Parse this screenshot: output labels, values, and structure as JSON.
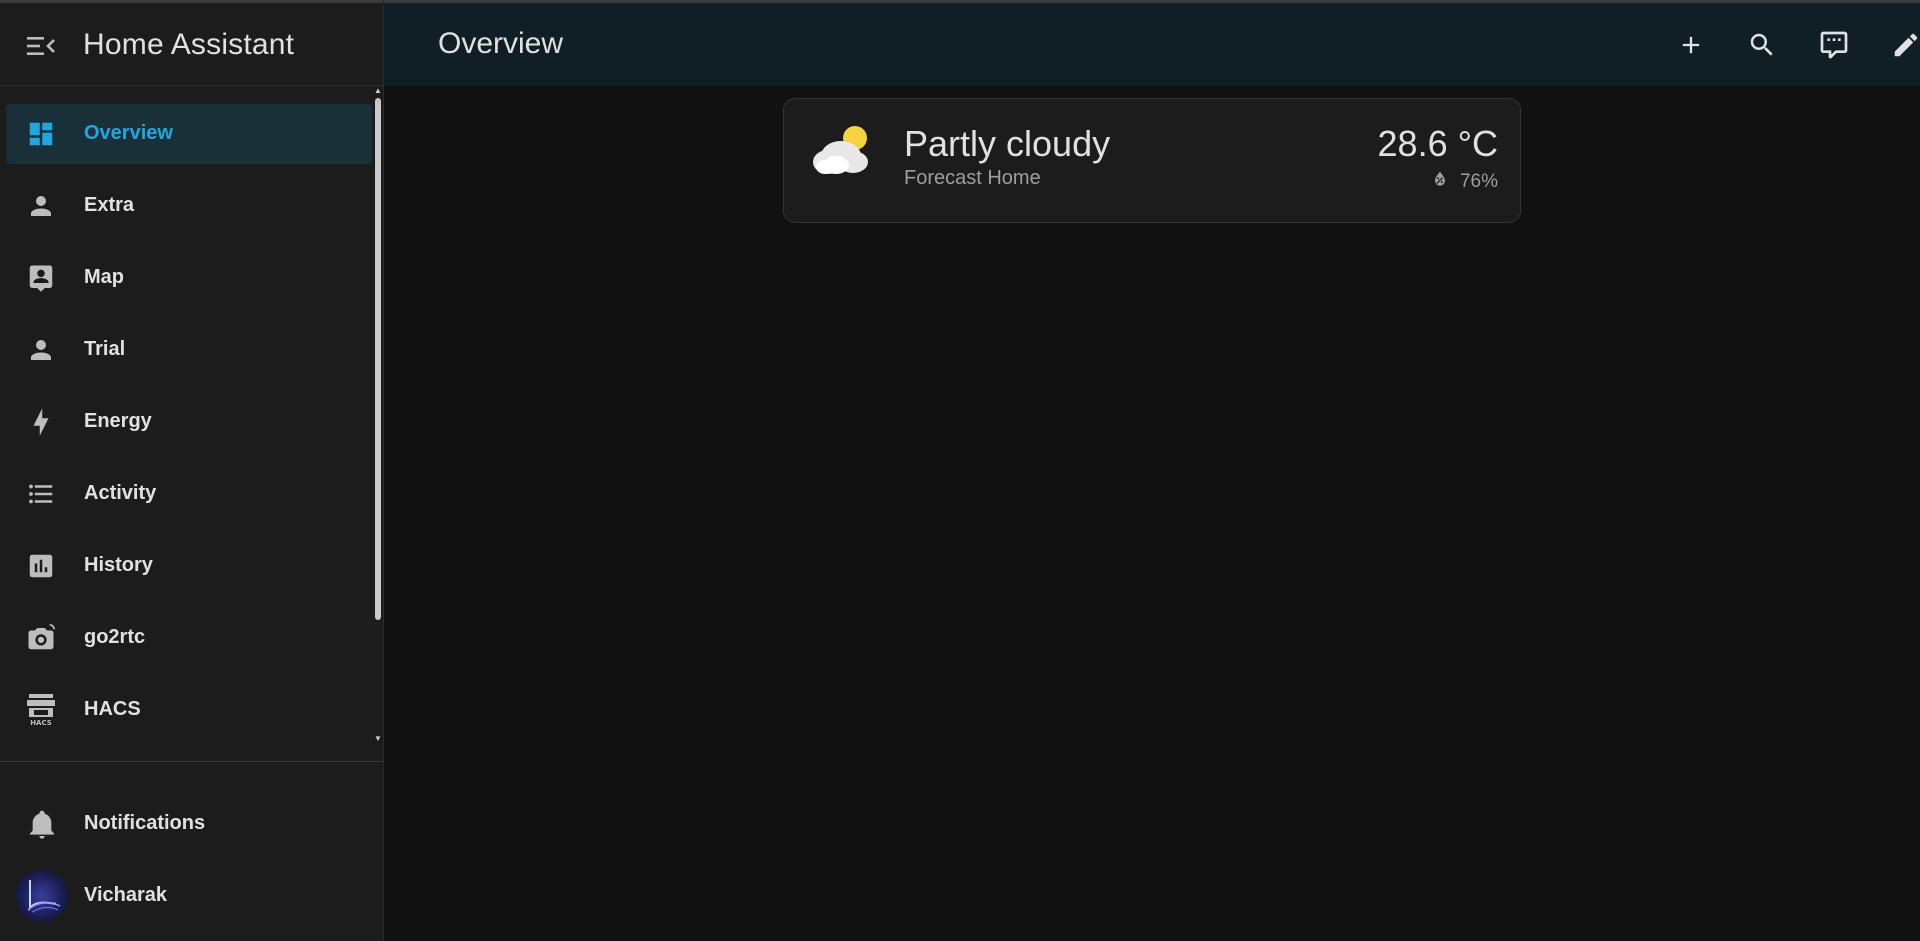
{
  "app": {
    "title": "Home Assistant"
  },
  "page": {
    "title": "Overview"
  },
  "sidebar": {
    "items": [
      {
        "label": "Overview",
        "icon": "dashboard-icon",
        "active": true
      },
      {
        "label": "Extra",
        "icon": "account-icon"
      },
      {
        "label": "Map",
        "icon": "map-account-box-icon"
      },
      {
        "label": "Trial",
        "icon": "account-icon"
      },
      {
        "label": "Energy",
        "icon": "lightning-bolt-icon"
      },
      {
        "label": "Activity",
        "icon": "format-list-bulleted-icon"
      },
      {
        "label": "History",
        "icon": "chart-box-icon"
      },
      {
        "label": "go2rtc",
        "icon": "camera-icon"
      },
      {
        "label": "HACS",
        "icon": "hacs-store-icon"
      }
    ],
    "notifications": {
      "label": "Notifications",
      "icon": "bell-icon"
    },
    "user": {
      "label": "Vicharak",
      "icon": "avatar"
    }
  },
  "toolbar": {
    "actions": [
      "add-icon",
      "search-icon",
      "assist-icon",
      "edit-pencil-icon"
    ]
  },
  "weather": {
    "state": "Partly cloudy",
    "name": "Forecast Home",
    "temperature": "28.6 °C",
    "humidity": "76%",
    "icon": "partly-cloudy-icon"
  },
  "colors": {
    "accent": "#1ea7e0",
    "active_bg": "#1a3038",
    "sidebar_bg": "#1c1c1c",
    "topbar_bg": "#101e25",
    "page_bg": "#111111",
    "sun": "#f5d33a"
  }
}
